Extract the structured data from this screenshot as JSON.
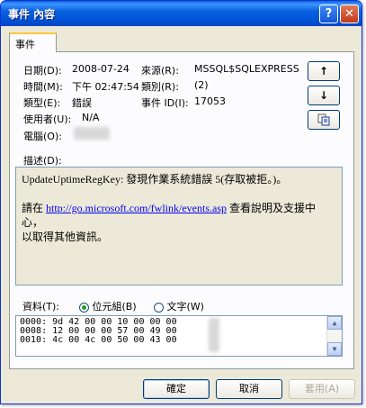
{
  "window": {
    "title": "事件 內容"
  },
  "tab": {
    "label": "事件"
  },
  "info": {
    "date_label": "日期(D):",
    "date_value": "2008-07-24",
    "source_label": "來源(R):",
    "source_value": "MSSQL$SQLEXPRESS",
    "time_label": "時間(M):",
    "time_value": "下午 02:47:54",
    "category_label": "類別(R):",
    "category_value": "(2)",
    "type_label": "類型(E):",
    "type_value": "錯誤",
    "eventid_label": "事件 ID(I):",
    "eventid_value": "17053",
    "user_label": "使用者(U):",
    "user_value": "N/A",
    "computer_label": "電腦(O):"
  },
  "side_buttons": {
    "up": "↑",
    "down": "↓"
  },
  "description": {
    "label": "描述(D):",
    "line1": "UpdateUptimeRegKey: 發現作業系統錯誤 5(存取被拒。)。",
    "pre_link": "請在 ",
    "link": "http://go.microsoft.com/fwlink/events.asp",
    "post_link": " 查看說明及支援中心，",
    "line3": "以取得其他資訊。"
  },
  "data_section": {
    "label": "資料(T):",
    "bytes_label": "位元組(B)",
    "words_label": "文字(W)",
    "rows": [
      "0000: 9d 42 00 00 10 00 00 00",
      "0008: 12 00 00 00 57 00 49 00",
      "0010: 4c 00 4c 00 50 00 43 00"
    ]
  },
  "buttons": {
    "ok": "確定",
    "cancel": "取消",
    "apply": "套用(A)"
  }
}
